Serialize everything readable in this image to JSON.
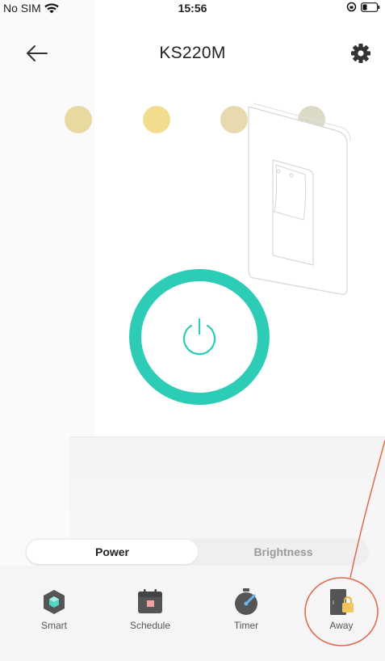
{
  "status_bar": {
    "carrier": "No SIM",
    "time": "15:56"
  },
  "header": {
    "title": "KS220M"
  },
  "presets": [
    {
      "color": "#e8d9a0"
    },
    {
      "color": "#f2dd8e"
    },
    {
      "color": "#e8d9ae"
    },
    {
      "color": "#ddd9c7"
    }
  ],
  "power": {
    "state": "on",
    "color": "#2dccb7"
  },
  "mode_tabs": {
    "power": "Power",
    "brightness": "Brightness",
    "selected": "power"
  },
  "toolbar": {
    "smart": "Smart",
    "schedule": "Schedule",
    "timer": "Timer",
    "away": "Away"
  },
  "colors": {
    "accent": "#2dccb7",
    "annotation": "#e06a50"
  }
}
